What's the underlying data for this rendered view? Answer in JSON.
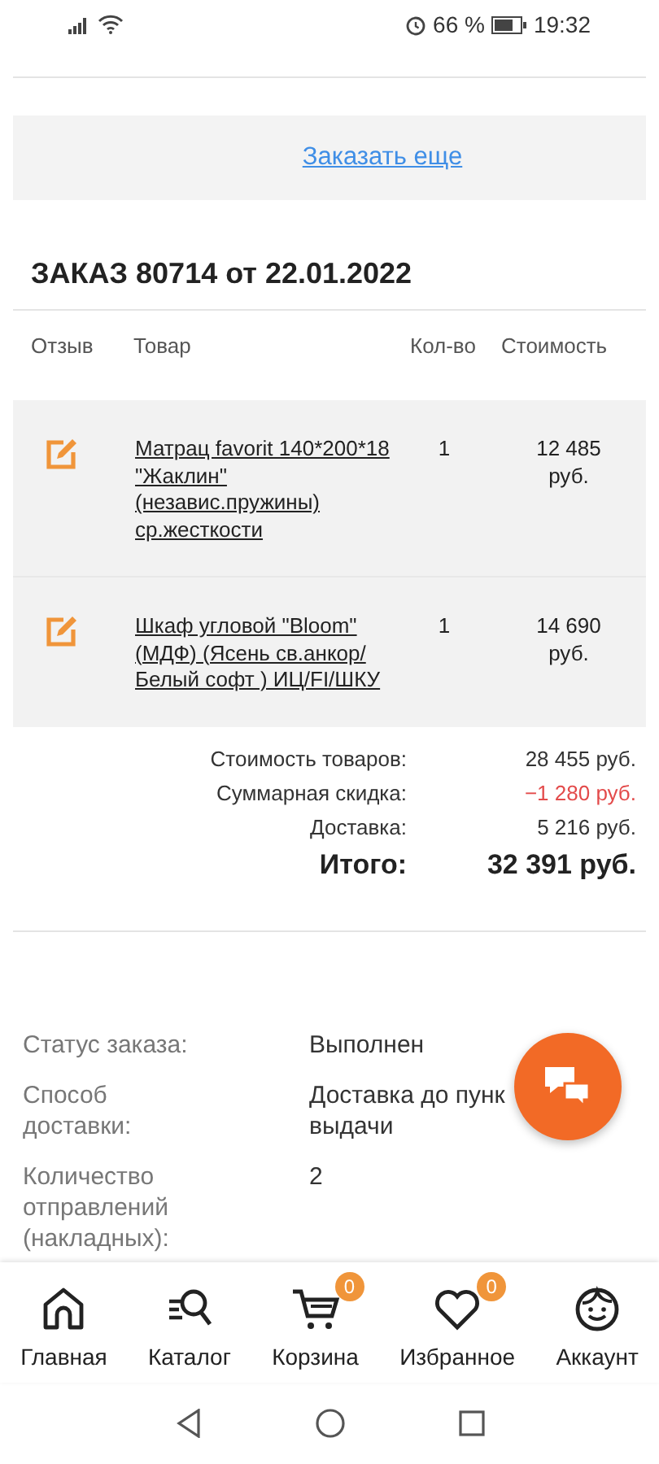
{
  "status_bar": {
    "battery_percent": "66 %",
    "time": "19:32"
  },
  "reorder_link": "Заказать еще",
  "order_title": "ЗАКАЗ 80714 от 22.01.2022",
  "table": {
    "columns": [
      "Отзыв",
      "Товар",
      "Кол-во",
      "Стоимость"
    ],
    "rows": [
      {
        "product": "Матрац favorit 140*200*18 \"Жаклин\" (независ.пружины) ср.жесткости",
        "qty": "1",
        "price": "12 485 руб."
      },
      {
        "product": "Шкаф угловой \"Bloom\" (МДФ) (Ясень св.анкор/ Белый софт ) ИЦ/FI/ШКУ",
        "qty": "1",
        "price": "14 690 руб."
      }
    ]
  },
  "summary": [
    {
      "label": "Стоимость товаров:",
      "value": "28 455 руб.",
      "kind": "normal"
    },
    {
      "label": "Суммарная скидка:",
      "value": "−1 280 руб.",
      "kind": "discount"
    },
    {
      "label": "Доставка:",
      "value": "5 216 руб.",
      "kind": "normal"
    },
    {
      "label": "Итого:",
      "value": "32 391 руб.",
      "kind": "total"
    }
  ],
  "details": [
    {
      "label": "Статус заказа:",
      "value_lines": [
        "Выполнен"
      ]
    },
    {
      "label": "Способ доставки:",
      "value_lines": [
        "Доставка до пунк",
        "выдачи"
      ]
    },
    {
      "label": "Количество отправлений (накладных):",
      "value_lines": [
        "2"
      ]
    }
  ],
  "bottom_nav": [
    {
      "label": "Главная"
    },
    {
      "label": "Каталог"
    },
    {
      "label": "Корзина",
      "badge": "0"
    },
    {
      "label": "Избранное",
      "badge": "0"
    },
    {
      "label": "Аккаунт"
    }
  ]
}
